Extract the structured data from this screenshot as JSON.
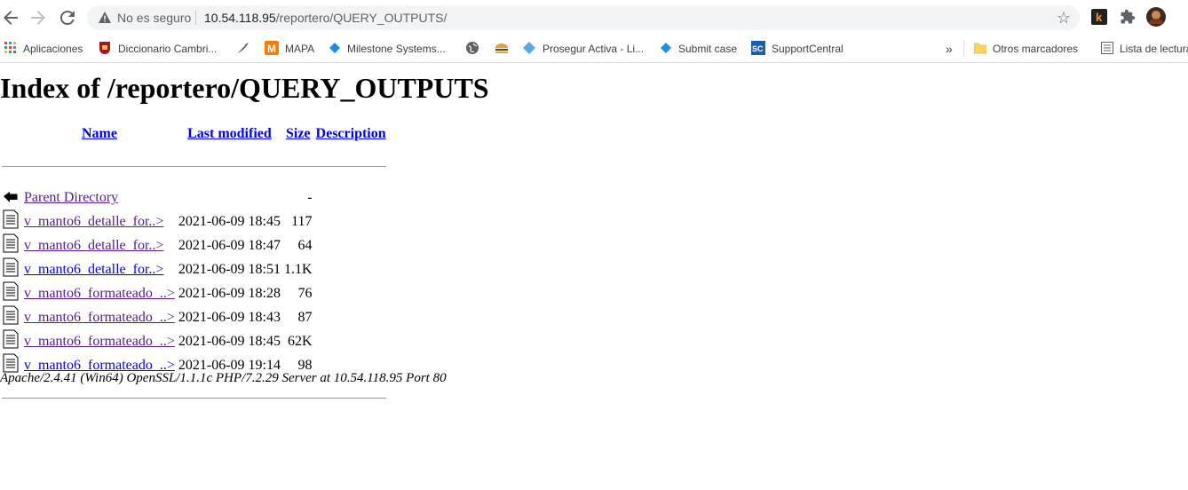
{
  "browser": {
    "security_status": "No es seguro",
    "url_host": "10.54.118.95",
    "url_path": "/reportero/QUERY_OUTPUTS/",
    "bookmarks": [
      {
        "label": "Aplicaciones",
        "icon": "apps-grid-icon"
      },
      {
        "label": "Diccionario Cambri...",
        "icon": "cambridge-shield-icon"
      },
      {
        "label": "",
        "icon": "feather-icon"
      },
      {
        "label": "MAPA",
        "icon": "mapa-icon"
      },
      {
        "label": "Milestone Systems...",
        "icon": "diamond-icon"
      },
      {
        "label": "",
        "icon": "globe-icon"
      },
      {
        "label": "",
        "icon": "burger-icon"
      },
      {
        "label": "Prosegur Activa - Li...",
        "icon": "diamond-icon"
      },
      {
        "label": "Submit case",
        "icon": "diamond-icon"
      },
      {
        "label": "SupportCentral",
        "icon": "sc-icon"
      }
    ],
    "more_bookmarks": "»",
    "other_bookmarks": "Otros marcadores",
    "reading_list": "Lista de lectura"
  },
  "page": {
    "title": "Index of /reportero/QUERY_OUTPUTS",
    "columns": {
      "name": "Name",
      "last_modified": "Last modified",
      "size": "Size",
      "description": "Description"
    },
    "parent": {
      "name": "Parent Directory",
      "size": "-"
    },
    "files": [
      {
        "name": "v_manto6_detalle_for..>",
        "modified": "2021-06-09 18:45",
        "size": "117",
        "visited": true
      },
      {
        "name": "v_manto6_detalle_for..>",
        "modified": "2021-06-09 18:47",
        "size": "64",
        "visited": true
      },
      {
        "name": "v_manto6_detalle_for..>",
        "modified": "2021-06-09 18:51",
        "size": "1.1K",
        "visited": false
      },
      {
        "name": "v_manto6_formateado_..>",
        "modified": "2021-06-09 18:28",
        "size": "76",
        "visited": true
      },
      {
        "name": "v_manto6_formateado_..>",
        "modified": "2021-06-09 18:43",
        "size": "87",
        "visited": true
      },
      {
        "name": "v_manto6_formateado_..>",
        "modified": "2021-06-09 18:45",
        "size": "62K",
        "visited": true
      },
      {
        "name": "v_manto6_formateado_..>",
        "modified": "2021-06-09 19:14",
        "size": "98",
        "visited": false
      }
    ],
    "footer": "Apache/2.4.41 (Win64) OpenSSL/1.1.1c PHP/7.2.29 Server at 10.54.118.95 Port 80"
  },
  "colors": {
    "link": "#0000ee",
    "visited": "#551a8b"
  }
}
